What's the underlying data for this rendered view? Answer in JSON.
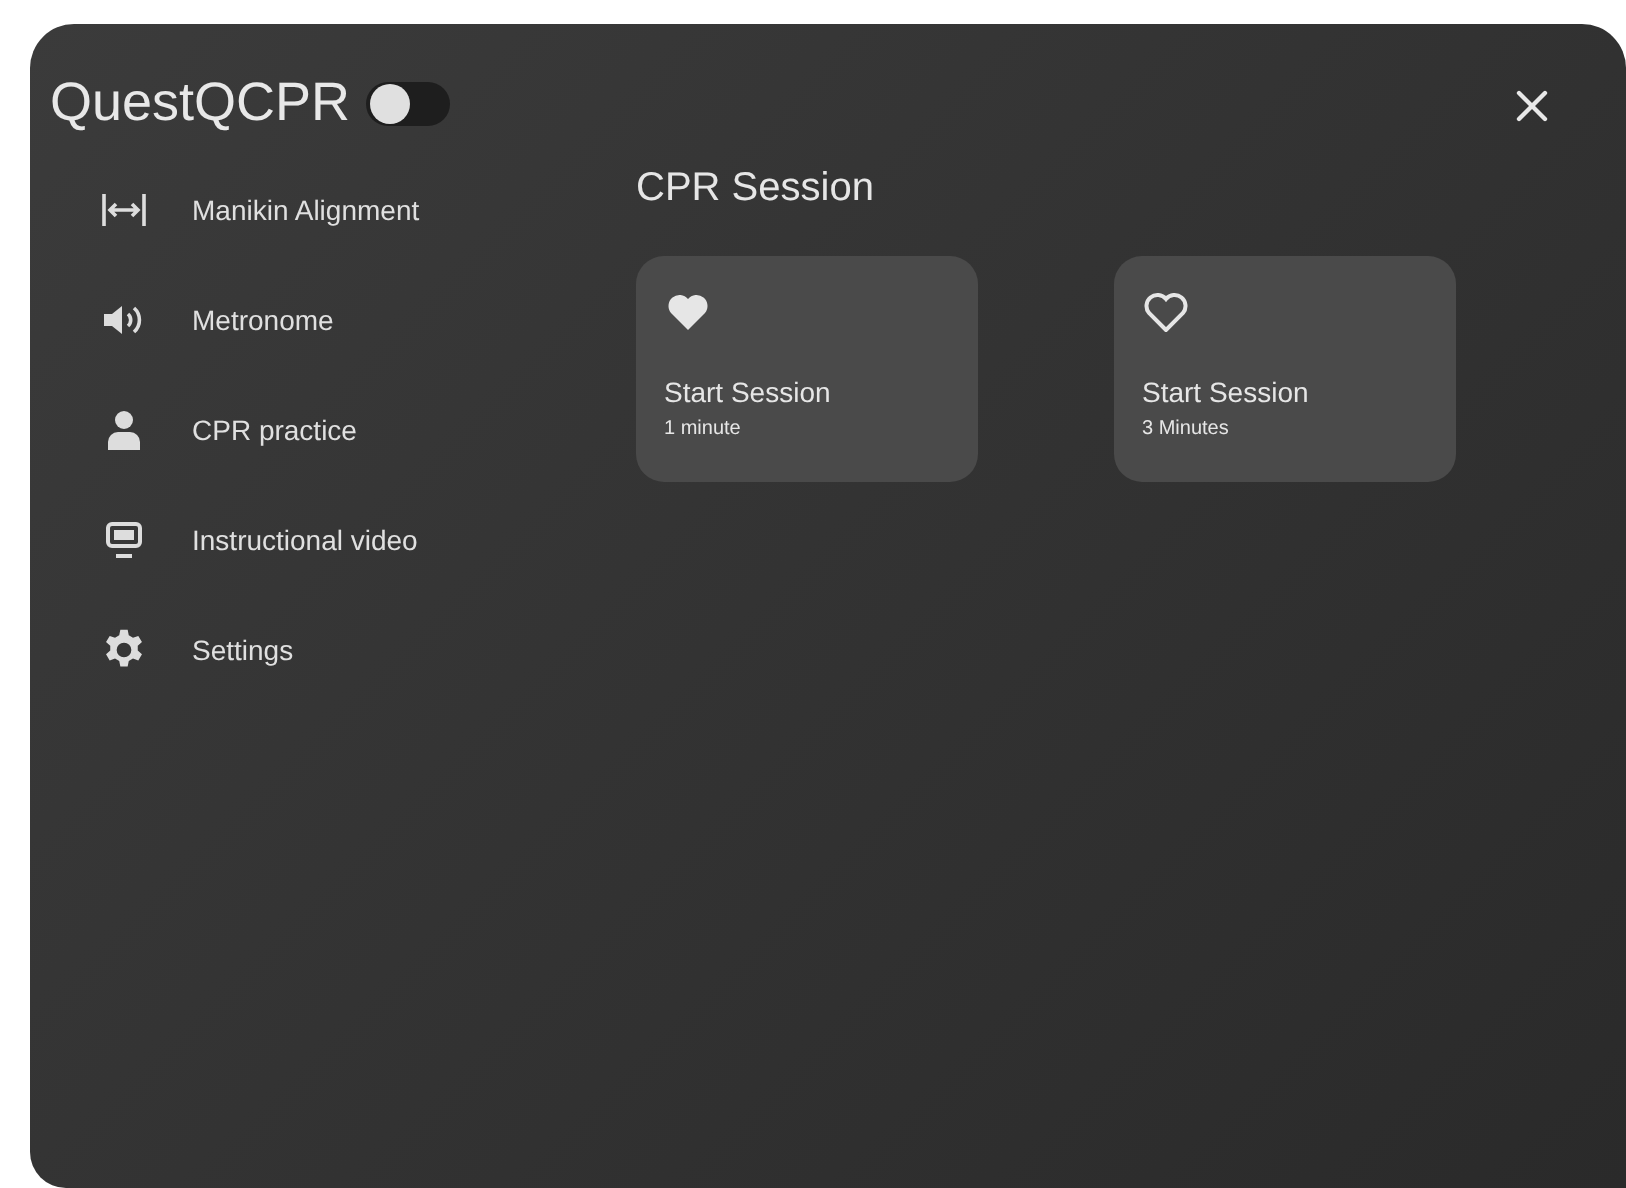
{
  "app": {
    "title": "QuestQCPR",
    "toggle_on": false
  },
  "sidebar": {
    "items": [
      {
        "label": "Manikin Alignment"
      },
      {
        "label": "Metronome"
      },
      {
        "label": "CPR practice"
      },
      {
        "label": "Instructional video"
      },
      {
        "label": "Settings"
      }
    ]
  },
  "content": {
    "heading": "CPR Session",
    "cards": [
      {
        "kind": "filled",
        "title": "Start Session",
        "subtitle": "1 minute"
      },
      {
        "kind": "outline",
        "title": "Start Session",
        "subtitle": "3 Minutes"
      }
    ]
  }
}
